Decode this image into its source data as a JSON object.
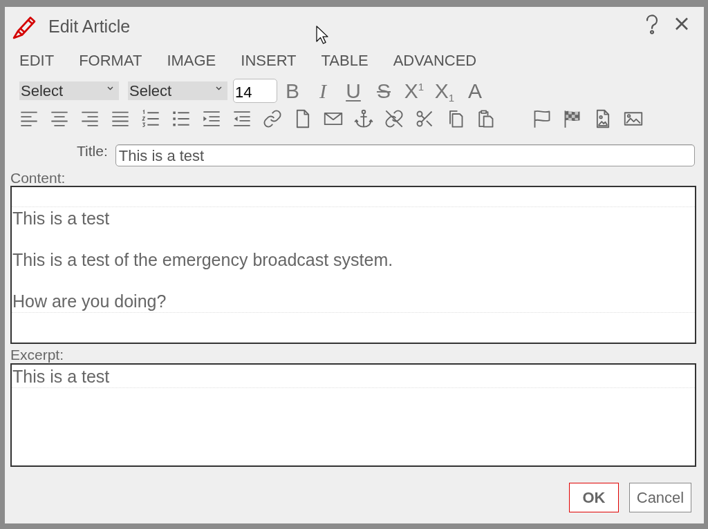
{
  "dialog": {
    "title": "Edit Article"
  },
  "menu": [
    "EDIT",
    "FORMAT",
    "IMAGE",
    "INSERT",
    "TABLE",
    "ADVANCED"
  ],
  "toolbar": {
    "selects": [
      {
        "value": "Select"
      },
      {
        "value": "Select"
      }
    ],
    "font_size": {
      "value": "14"
    },
    "format_buttons": [
      {
        "kind": "bold",
        "label": "B"
      },
      {
        "kind": "italic",
        "label": "I"
      },
      {
        "kind": "underline",
        "label": "U"
      },
      {
        "kind": "strikethrough",
        "label": "S"
      },
      {
        "kind": "superscript",
        "label": "X$^{1}$"
      },
      {
        "kind": "subscript",
        "label": "X$_{1}$"
      },
      {
        "kind": "font-color",
        "label": "A"
      }
    ]
  },
  "form": {
    "title_label": "Title:",
    "title_value": "This is a test",
    "content_label": "Content:",
    "content_paragraphs": [
      "This is a test",
      "This is a test of the emergency broadcast system.",
      "How are you doing?"
    ],
    "excerpt_label": "Excerpt:",
    "excerpt_value": "This is a test"
  },
  "buttons": [
    {
      "kind": "confirm",
      "label": "OK"
    },
    {
      "kind": "cancel",
      "label": "Cancel"
    }
  ]
}
